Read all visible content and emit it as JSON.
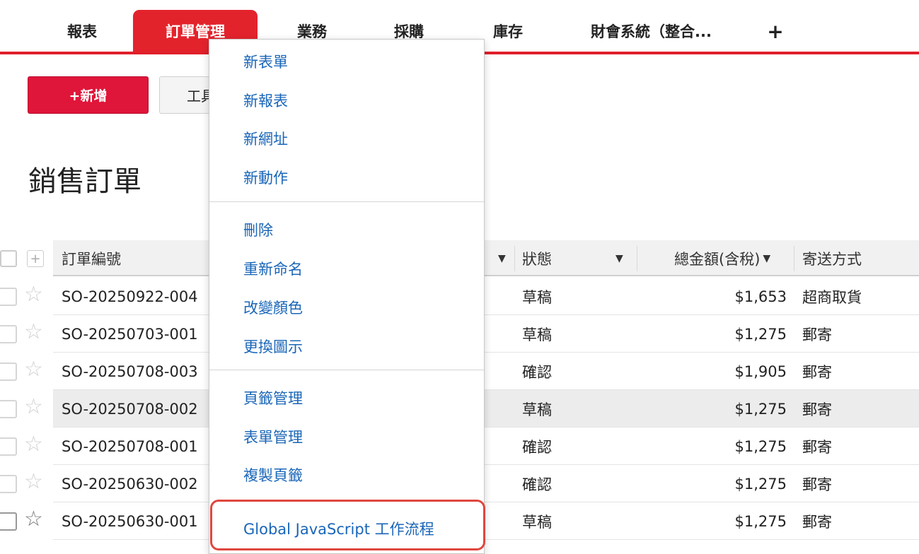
{
  "tabs": {
    "reports": "報表",
    "orders": "訂單管理",
    "sales": "業務",
    "purchasing": "採購",
    "inventory": "庫存",
    "finance": "財會系統（整合...",
    "add": "+"
  },
  "toolbar": {
    "new_label": "+新增",
    "tools_label": "工具"
  },
  "page_title": "銷售訂單",
  "table": {
    "headers": {
      "order_no": "訂單編號",
      "status": "狀態",
      "total": "總金額(含稅)",
      "shipping": "寄送方式"
    },
    "header_plus": "+",
    "rows": [
      {
        "order_no": "SO-20250922-004",
        "status": "草稿",
        "total": "$1,653",
        "shipping": "超商取貨"
      },
      {
        "order_no": "SO-20250703-001",
        "status": "草稿",
        "total": "$1,275",
        "shipping": "郵寄"
      },
      {
        "order_no": "SO-20250708-003",
        "status": "確認",
        "total": "$1,905",
        "shipping": "郵寄"
      },
      {
        "order_no": "SO-20250708-002",
        "status": "草稿",
        "total": "$1,275",
        "shipping": "郵寄"
      },
      {
        "order_no": "SO-20250708-001",
        "status": "確認",
        "total": "$1,275",
        "shipping": "郵寄"
      },
      {
        "order_no": "SO-20250630-002",
        "status": "確認",
        "total": "$1,275",
        "shipping": "郵寄"
      },
      {
        "order_no": "SO-20250630-001",
        "status": "草稿",
        "total": "$1,275",
        "shipping": "郵寄"
      }
    ]
  },
  "menu": {
    "new_form": "新表單",
    "new_report": "新報表",
    "new_url": "新網址",
    "new_action": "新動作",
    "delete": "刪除",
    "rename": "重新命名",
    "change_color": "改變顏色",
    "change_icon": "更換圖示",
    "tab_management": "頁籤管理",
    "form_management": "表單管理",
    "copy_tab": "複製頁籤",
    "global_js_workflow": "Global JavaScript 工作流程"
  },
  "colors": {
    "accent_red": "#e3232c",
    "new_button_red": "#e0153a",
    "menu_link_blue": "#1a66b8",
    "highlight_outline": "#e0463e"
  }
}
